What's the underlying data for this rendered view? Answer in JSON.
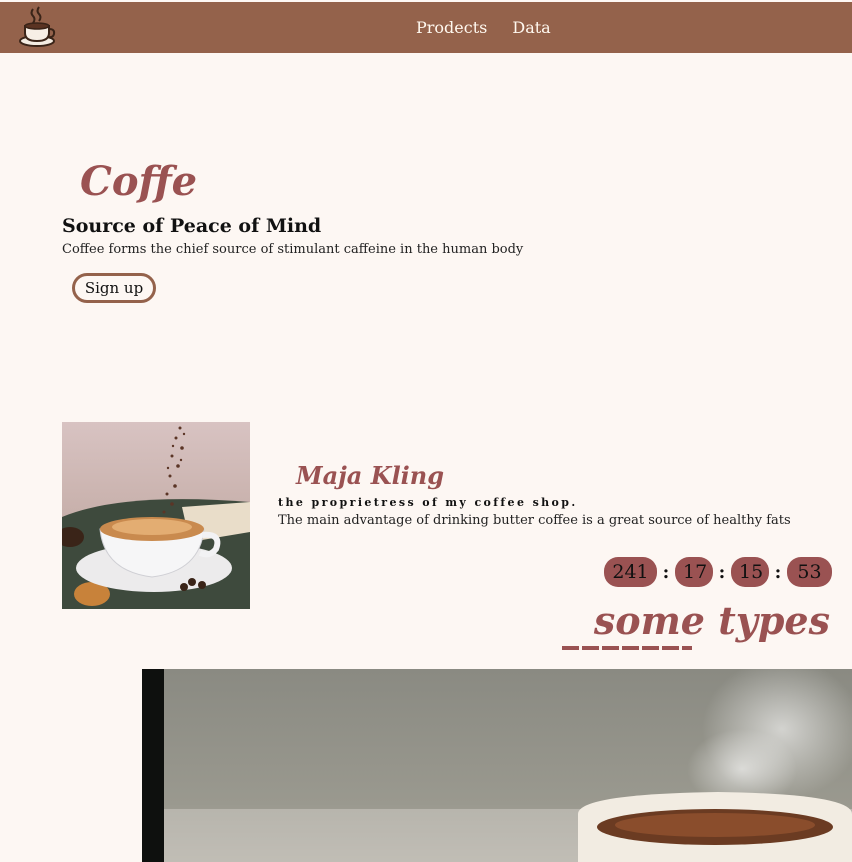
{
  "nav": {
    "logo_icon": "coffee-cup-logo-icon",
    "links": [
      "Prodects",
      "Data"
    ]
  },
  "hero": {
    "title": "Coffe",
    "subtitle": "Source of Peace of Mind",
    "description": "Coffee forms the chief source of stimulant caffeine in the human body",
    "signup_label": "Sign up"
  },
  "profile": {
    "name": "Maja Kling",
    "role": "the proprietress of my coffee shop.",
    "description": "The main advantage of drinking butter coffee is a great source of healthy fats",
    "photo": "coffee-cup-photo"
  },
  "countdown": {
    "days": "241",
    "hours": "17",
    "minutes": "15",
    "seconds": "53",
    "separator": ":"
  },
  "types": {
    "heading": "some types"
  },
  "banner": {
    "image": "steaming-coffee-cup-photo"
  },
  "colors": {
    "nav_bg": "#94624b",
    "accent": "#9a5252",
    "page_bg": "#fdf7f3"
  }
}
